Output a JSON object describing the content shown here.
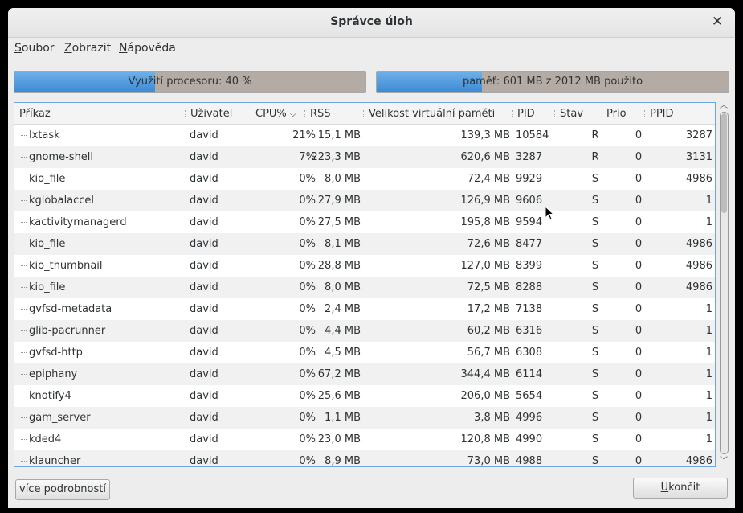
{
  "window": {
    "title": "Správce úloh"
  },
  "menu": [
    {
      "label": "Soubor",
      "key": "S",
      "rest": "oubor"
    },
    {
      "label": "Zobrazit",
      "key": "Z",
      "rest": "obrazit"
    },
    {
      "label": "Nápověda",
      "key": "N",
      "rest": "ápověda"
    }
  ],
  "cpu": {
    "label": "Využití procesoru: 40 %",
    "percent": 40
  },
  "memory": {
    "label": "paměť: 601 MB z 2012 MB použito",
    "used_mb": 601,
    "total_mb": 2012
  },
  "columns": [
    "Příkaz",
    "Uživatel",
    "CPU%",
    "RSS",
    "Velikost virtuální paměti",
    "PID",
    "Stav",
    "Prio",
    "PPID"
  ],
  "sort_column": "CPU%",
  "rows": [
    [
      "lxtask",
      "david",
      "21%",
      "15,1 MB",
      "139,3 MB",
      "10584",
      "R",
      "0",
      "3287"
    ],
    [
      "gnome-shell",
      "david",
      "7%",
      "223,3 MB",
      "620,6 MB",
      "3287",
      "R",
      "0",
      "3131"
    ],
    [
      "kio_file",
      "david",
      "0%",
      "8,0 MB",
      "72,4 MB",
      "9929",
      "S",
      "0",
      "4986"
    ],
    [
      "kglobalaccel",
      "david",
      "0%",
      "27,9 MB",
      "126,9 MB",
      "9606",
      "S",
      "0",
      "1"
    ],
    [
      "kactivitymanagerd",
      "david",
      "0%",
      "27,5 MB",
      "195,8 MB",
      "9594",
      "S",
      "0",
      "1"
    ],
    [
      "kio_file",
      "david",
      "0%",
      "8,1 MB",
      "72,6 MB",
      "8477",
      "S",
      "0",
      "4986"
    ],
    [
      "kio_thumbnail",
      "david",
      "0%",
      "28,8 MB",
      "127,0 MB",
      "8399",
      "S",
      "0",
      "4986"
    ],
    [
      "kio_file",
      "david",
      "0%",
      "8,0 MB",
      "72,5 MB",
      "8288",
      "S",
      "0",
      "4986"
    ],
    [
      "gvfsd-metadata",
      "david",
      "0%",
      "2,4 MB",
      "17,2 MB",
      "7138",
      "S",
      "0",
      "1"
    ],
    [
      "glib-pacrunner",
      "david",
      "0%",
      "4,4 MB",
      "60,2 MB",
      "6316",
      "S",
      "0",
      "1"
    ],
    [
      "gvfsd-http",
      "david",
      "0%",
      "4,5 MB",
      "56,7 MB",
      "6308",
      "S",
      "0",
      "1"
    ],
    [
      "epiphany",
      "david",
      "0%",
      "67,2 MB",
      "344,4 MB",
      "6114",
      "S",
      "0",
      "1"
    ],
    [
      "knotify4",
      "david",
      "0%",
      "25,6 MB",
      "206,0 MB",
      "5654",
      "S",
      "0",
      "1"
    ],
    [
      "gam_server",
      "david",
      "0%",
      "1,1 MB",
      "3,8 MB",
      "4996",
      "S",
      "0",
      "1"
    ],
    [
      "kded4",
      "david",
      "0%",
      "23,0 MB",
      "120,8 MB",
      "4990",
      "S",
      "0",
      "1"
    ],
    [
      "klauncher",
      "david",
      "0%",
      "8,9 MB",
      "73,0 MB",
      "4988",
      "S",
      "0",
      "4986"
    ]
  ],
  "buttons": {
    "details": "více podrobností",
    "quit": "Ukončit",
    "quit_key": "U",
    "quit_rest": "končit"
  },
  "colors": {
    "accent": "#4a90d9",
    "bar_bg": "#b4aca4"
  }
}
